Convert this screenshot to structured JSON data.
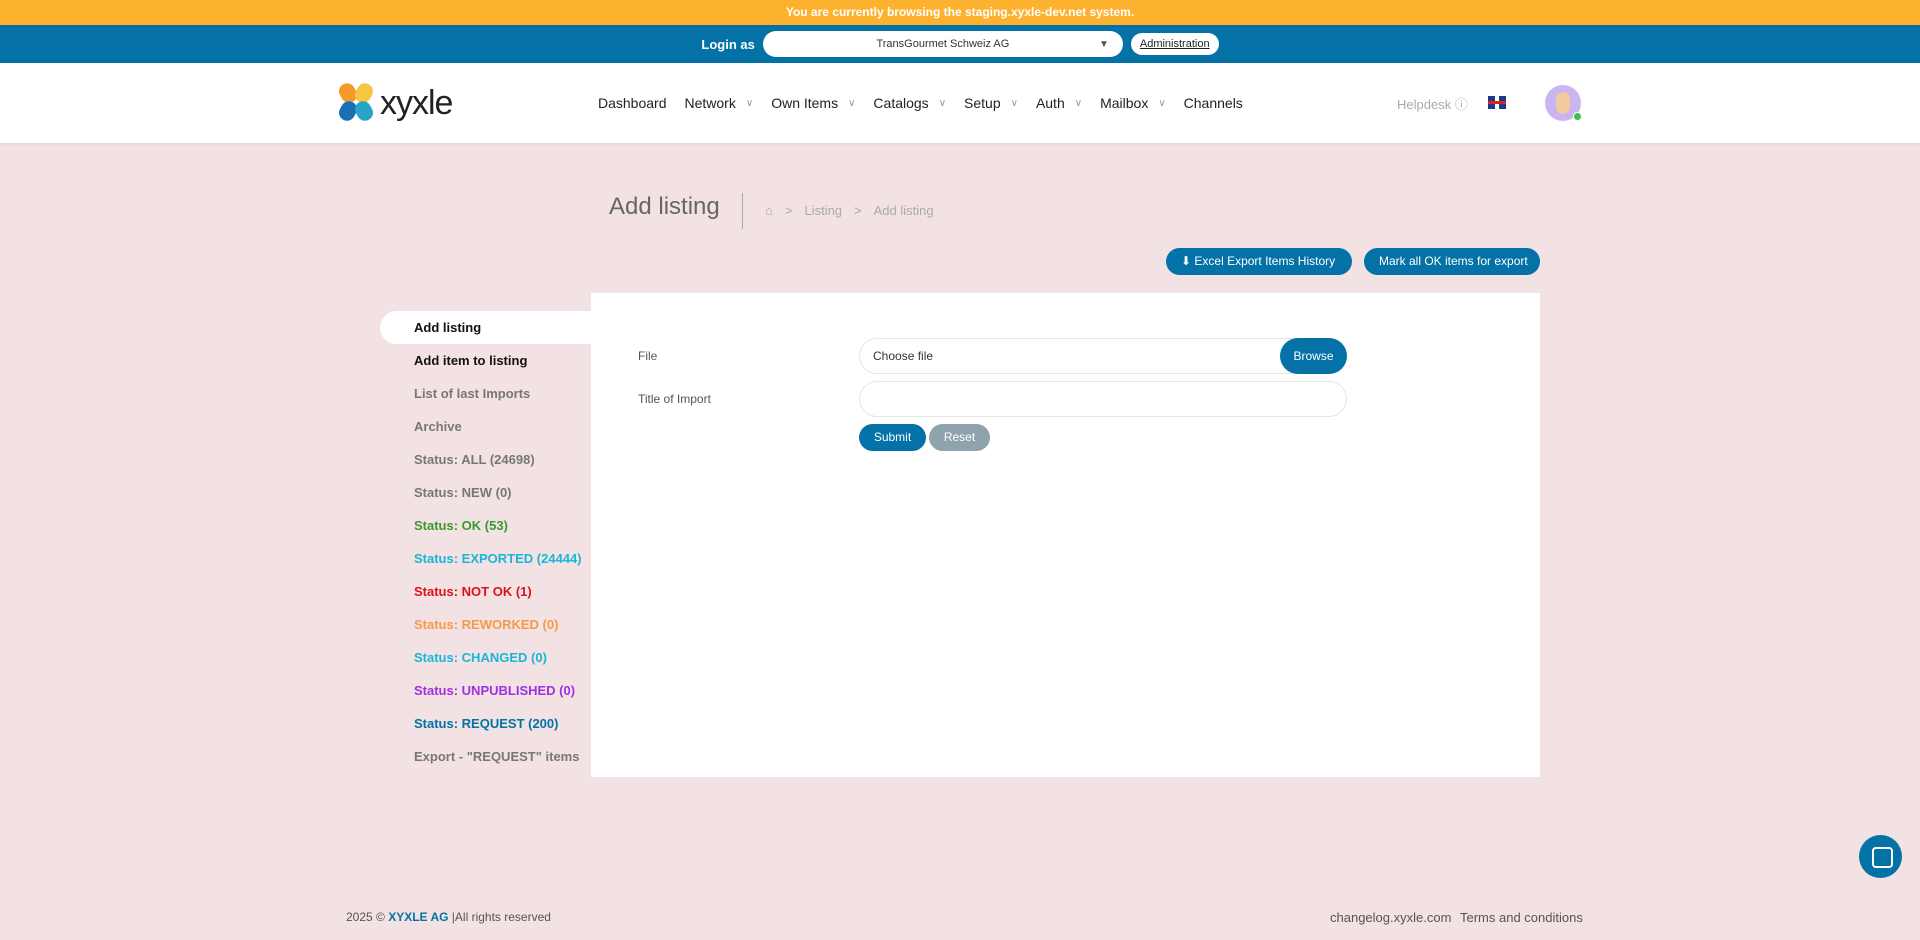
{
  "staging_banner": "You are currently browsing the staging.xyxle-dev.net system.",
  "login": {
    "label": "Login as",
    "selected": "TransGourmet Schweiz AG",
    "admin": "Administration"
  },
  "logo": "xyxle",
  "nav": [
    {
      "label": "Dashboard",
      "dropdown": false
    },
    {
      "label": "Network",
      "dropdown": true
    },
    {
      "label": "Own Items",
      "dropdown": true
    },
    {
      "label": "Catalogs",
      "dropdown": true
    },
    {
      "label": "Setup",
      "dropdown": true
    },
    {
      "label": "Auth",
      "dropdown": true
    },
    {
      "label": "Mailbox",
      "dropdown": true
    },
    {
      "label": "Channels",
      "dropdown": false
    }
  ],
  "helpdesk": "Helpdesk",
  "page": {
    "title": "Add listing",
    "breadcrumb": [
      "Listing",
      "Add listing"
    ]
  },
  "actions": {
    "excel": "Excel Export Items History",
    "mark": "Mark all OK items for export"
  },
  "sidebar": [
    {
      "label": "Add listing",
      "color": "#111111"
    },
    {
      "label": "Add item to listing",
      "color": "#111111"
    },
    {
      "label": "List of last Imports",
      "color": "#777777"
    },
    {
      "label": "Archive",
      "color": "#777777"
    },
    {
      "label": "Status: ALL (24698)",
      "color": "#777777"
    },
    {
      "label": "Status: NEW (0)",
      "color": "#777777"
    },
    {
      "label": "Status: OK (53)",
      "color": "#3a9a2a"
    },
    {
      "label": "Status: EXPORTED (24444)",
      "color": "#1ab5d8"
    },
    {
      "label": "Status: NOT OK (1)",
      "color": "#e0101a"
    },
    {
      "label": "Status: REWORKED (0)",
      "color": "#f59a4a"
    },
    {
      "label": "Status: CHANGED (0)",
      "color": "#1ab5d8"
    },
    {
      "label": "Status: UNPUBLISHED (0)",
      "color": "#a030e0"
    },
    {
      "label": "Status: REQUEST (200)",
      "color": "#0472a6"
    },
    {
      "label": "Export - \"REQUEST\" items",
      "color": "#777777"
    }
  ],
  "form": {
    "file_label": "File",
    "file_placeholder": "Choose file",
    "browse": "Browse",
    "title_label": "Title of Import",
    "title_value": "",
    "submit": "Submit",
    "reset": "Reset"
  },
  "footer": {
    "year": "2025 ©",
    "company": "XYXLE AG",
    "rights": "|All rights reserved",
    "changelog": "changelog.xyxle.com",
    "terms": "Terms and conditions"
  }
}
